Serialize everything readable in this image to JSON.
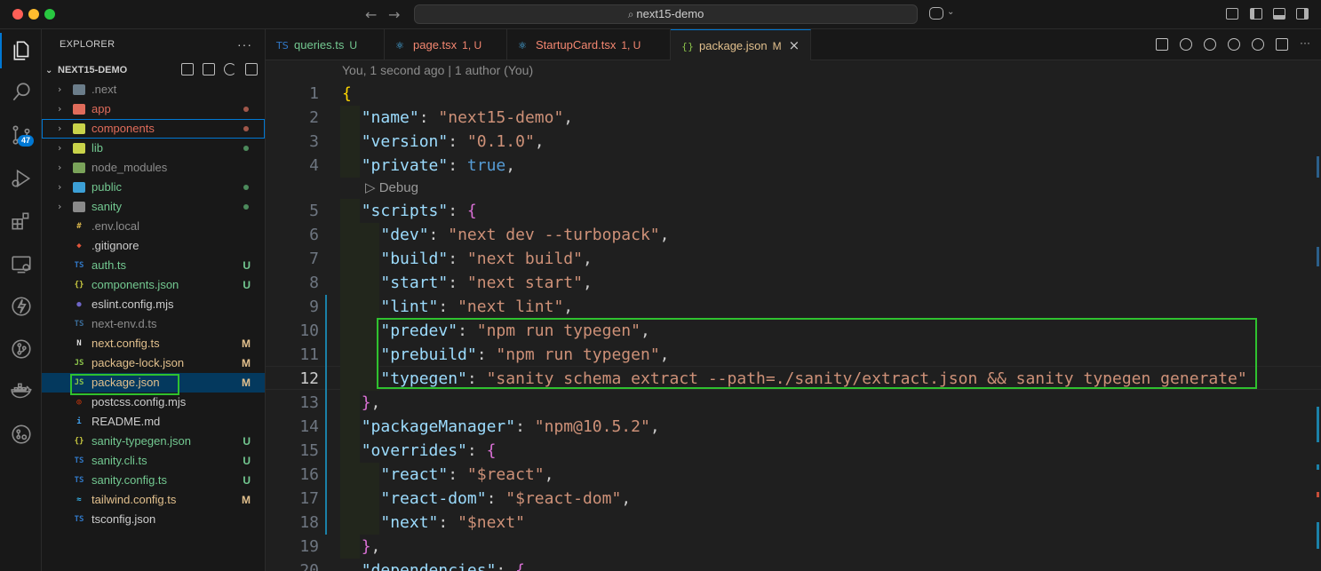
{
  "window": {
    "title": "next15-demo"
  },
  "activity": {
    "source_control_badge": "47"
  },
  "explorer": {
    "header": "EXPLORER",
    "more": "···",
    "project": "NEXT15-DEMO",
    "items": [
      {
        "name": ".next",
        "folder": true,
        "color": "#8c8c8c",
        "icon_color": "#6b7d8a",
        "status": "",
        "dot": ""
      },
      {
        "name": "app",
        "folder": true,
        "color": "#e06c5b",
        "icon_color": "#e06c5b",
        "status": "",
        "dot": "#a0574a"
      },
      {
        "name": "components",
        "folder": true,
        "color": "#e06c5b",
        "icon_color": "#c9d34a",
        "status": "",
        "dot": "#a0574a"
      },
      {
        "name": "lib",
        "folder": true,
        "color": "#73c991",
        "icon_color": "#c9d34a",
        "status": "",
        "dot": "#4c8a5c"
      },
      {
        "name": "node_modules",
        "folder": true,
        "color": "#8c8c8c",
        "icon_color": "#7aa35a",
        "status": "",
        "dot": ""
      },
      {
        "name": "public",
        "folder": true,
        "color": "#73c991",
        "icon_color": "#3c9fd6",
        "status": "",
        "dot": "#4c8a5c"
      },
      {
        "name": "sanity",
        "folder": true,
        "color": "#73c991",
        "icon_color": "#8a8a8a",
        "status": "",
        "dot": "#4c8a5c"
      },
      {
        "name": ".env.local",
        "folder": false,
        "color": "#8c8c8c",
        "icon_color": "#d4b24a",
        "glyph": "#",
        "status": ""
      },
      {
        "name": ".gitignore",
        "folder": false,
        "color": "#cccccc",
        "icon_color": "#e0553b",
        "glyph": "◆",
        "status": ""
      },
      {
        "name": "auth.ts",
        "folder": false,
        "color": "#73c991",
        "icon_color": "#3178c6",
        "glyph": "TS",
        "status": "U"
      },
      {
        "name": "components.json",
        "folder": false,
        "color": "#73c991",
        "icon_color": "#cbcb41",
        "glyph": "{}",
        "status": "U"
      },
      {
        "name": "eslint.config.mjs",
        "folder": false,
        "color": "#cccccc",
        "icon_color": "#6e65c6",
        "glyph": "●",
        "status": ""
      },
      {
        "name": "next-env.d.ts",
        "folder": false,
        "color": "#8c8c8c",
        "icon_color": "#3b6d99",
        "glyph": "TS",
        "status": ""
      },
      {
        "name": "next.config.ts",
        "folder": false,
        "color": "#e2c08d",
        "icon_color": "#e0e0e0",
        "glyph": "N",
        "status": "M"
      },
      {
        "name": "package-lock.json",
        "folder": false,
        "color": "#e2c08d",
        "icon_color": "#8bc34a",
        "glyph": "JS",
        "status": "M"
      },
      {
        "name": "package.json",
        "folder": false,
        "color": "#e2c08d",
        "icon_color": "#8bc34a",
        "glyph": "JS",
        "status": "M",
        "selected": true
      },
      {
        "name": "postcss.config.mjs",
        "folder": false,
        "color": "#cccccc",
        "icon_color": "#dd3a0a",
        "glyph": "◎",
        "status": ""
      },
      {
        "name": "README.md",
        "folder": false,
        "color": "#cccccc",
        "icon_color": "#42a5f5",
        "glyph": "i",
        "status": ""
      },
      {
        "name": "sanity-typegen.json",
        "folder": false,
        "color": "#73c991",
        "icon_color": "#cbcb41",
        "glyph": "{}",
        "status": "U"
      },
      {
        "name": "sanity.cli.ts",
        "folder": false,
        "color": "#73c991",
        "icon_color": "#3178c6",
        "glyph": "TS",
        "status": "U"
      },
      {
        "name": "sanity.config.ts",
        "folder": false,
        "color": "#73c991",
        "icon_color": "#3178c6",
        "glyph": "TS",
        "status": "U"
      },
      {
        "name": "tailwind.config.ts",
        "folder": false,
        "color": "#e2c08d",
        "icon_color": "#38bdf8",
        "glyph": "≈",
        "status": "M"
      },
      {
        "name": "tsconfig.json",
        "folder": false,
        "color": "#cccccc",
        "icon_color": "#3178c6",
        "glyph": "TS",
        "status": ""
      }
    ]
  },
  "tabs": [
    {
      "label": "queries.ts",
      "status": "U",
      "icon": "TS",
      "icon_color": "#3178c6",
      "label_color": "#73c991",
      "status_color": "#73c991"
    },
    {
      "label": "page.tsx",
      "status": "1, U",
      "icon": "⚛",
      "icon_color": "#4fc1ff",
      "label_color": "#f48771",
      "status_color": "#f48771"
    },
    {
      "label": "StartupCard.tsx",
      "status": "1, U",
      "icon": "⚛",
      "icon_color": "#4fc1ff",
      "label_color": "#f48771",
      "status_color": "#f48771"
    },
    {
      "label": "package.json",
      "status": "M",
      "icon": "{}",
      "icon_color": "#8bc34a",
      "label_color": "#e2c08d",
      "status_color": "#e2c08d",
      "close": "×"
    }
  ],
  "editor": {
    "blame": "You, 1 second ago | 1 author (You)",
    "codelens": "▷ Debug",
    "current_line": "12",
    "lines": [
      {
        "n": "1",
        "text": "{"
      },
      {
        "n": "2",
        "text": "  \"name\": \"next15-demo\","
      },
      {
        "n": "3",
        "text": "  \"version\": \"0.1.0\","
      },
      {
        "n": "4",
        "text": "  \"private\": true,"
      },
      {
        "n": "5",
        "text": "  \"scripts\": {"
      },
      {
        "n": "6",
        "text": "    \"dev\": \"next dev --turbopack\","
      },
      {
        "n": "7",
        "text": "    \"build\": \"next build\","
      },
      {
        "n": "8",
        "text": "    \"start\": \"next start\","
      },
      {
        "n": "9",
        "text": "    \"lint\": \"next lint\","
      },
      {
        "n": "10",
        "text": "    \"predev\": \"npm run typegen\","
      },
      {
        "n": "11",
        "text": "    \"prebuild\": \"npm run typegen\","
      },
      {
        "n": "12",
        "text": "    \"typegen\": \"sanity schema extract --path=./sanity/extract.json && sanity typegen generate\""
      },
      {
        "n": "13",
        "text": "  },"
      },
      {
        "n": "14",
        "text": "  \"packageManager\": \"npm@10.5.2\","
      },
      {
        "n": "15",
        "text": "  \"overrides\": {"
      },
      {
        "n": "16",
        "text": "    \"react\": \"$react\","
      },
      {
        "n": "17",
        "text": "    \"react-dom\": \"$react-dom\","
      },
      {
        "n": "18",
        "text": "    \"next\": \"$next\""
      },
      {
        "n": "19",
        "text": "  },"
      },
      {
        "n": "20",
        "text": "  \"dependencies\": {"
      }
    ]
  }
}
